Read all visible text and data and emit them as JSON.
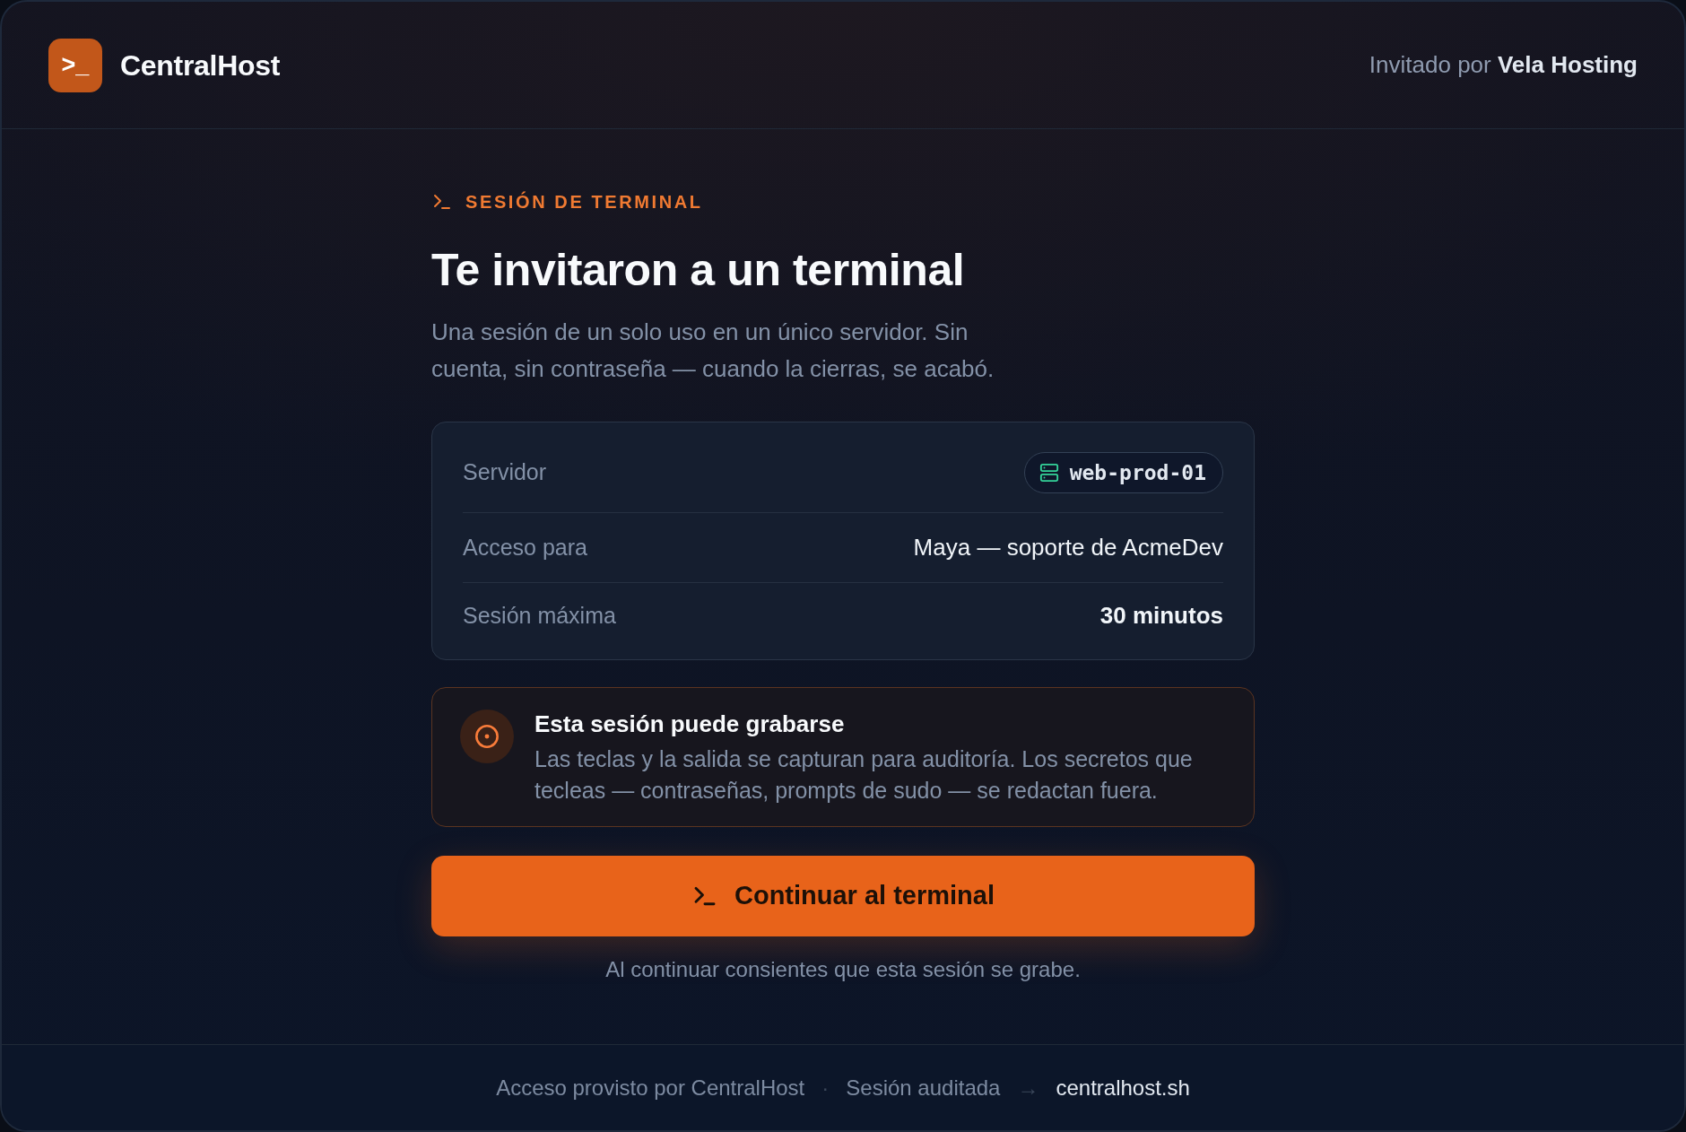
{
  "header": {
    "logo_glyph": ">_",
    "brand": "CentralHost",
    "invited_by": "Invitado por **Vela Hosting**"
  },
  "intro": {
    "eyebrow": "SESIÓN DE TERMINAL",
    "title": "Te invitaron a un terminal",
    "description": "Una sesión de un solo uso en un único servidor. Sin cuenta, sin contraseña — cuando la cierras, se acabó."
  },
  "details": [
    {
      "kind": "pill",
      "label": "Servidor",
      "value": "web-prod-01"
    },
    {
      "kind": "text",
      "label": "Acceso para",
      "value": "Maya — soporte de AcmeDev"
    },
    {
      "kind": "text",
      "label": "Sesión máxima",
      "value": "30 minutos"
    }
  ],
  "notice": {
    "title": "Esta sesión puede grabarse",
    "body": "Las teclas y la salida se capturan para auditoría. Los secretos que tecleas — contraseñas, prompts de sudo — se redactan fuera."
  },
  "primary_button": {
    "label": "Continuar al terminal"
  },
  "consent_note": "Al continuar consientes que esta sesión se grabe.",
  "footer": [
    {
      "kind": "text",
      "text": "Acceso provisto por CentralHost"
    },
    {
      "kind": "separator",
      "text": "·"
    },
    {
      "kind": "text",
      "text": "Sesión auditada"
    },
    {
      "kind": "separator",
      "text": "→"
    },
    {
      "kind": "link",
      "text": "centralhost.sh"
    }
  ]
}
